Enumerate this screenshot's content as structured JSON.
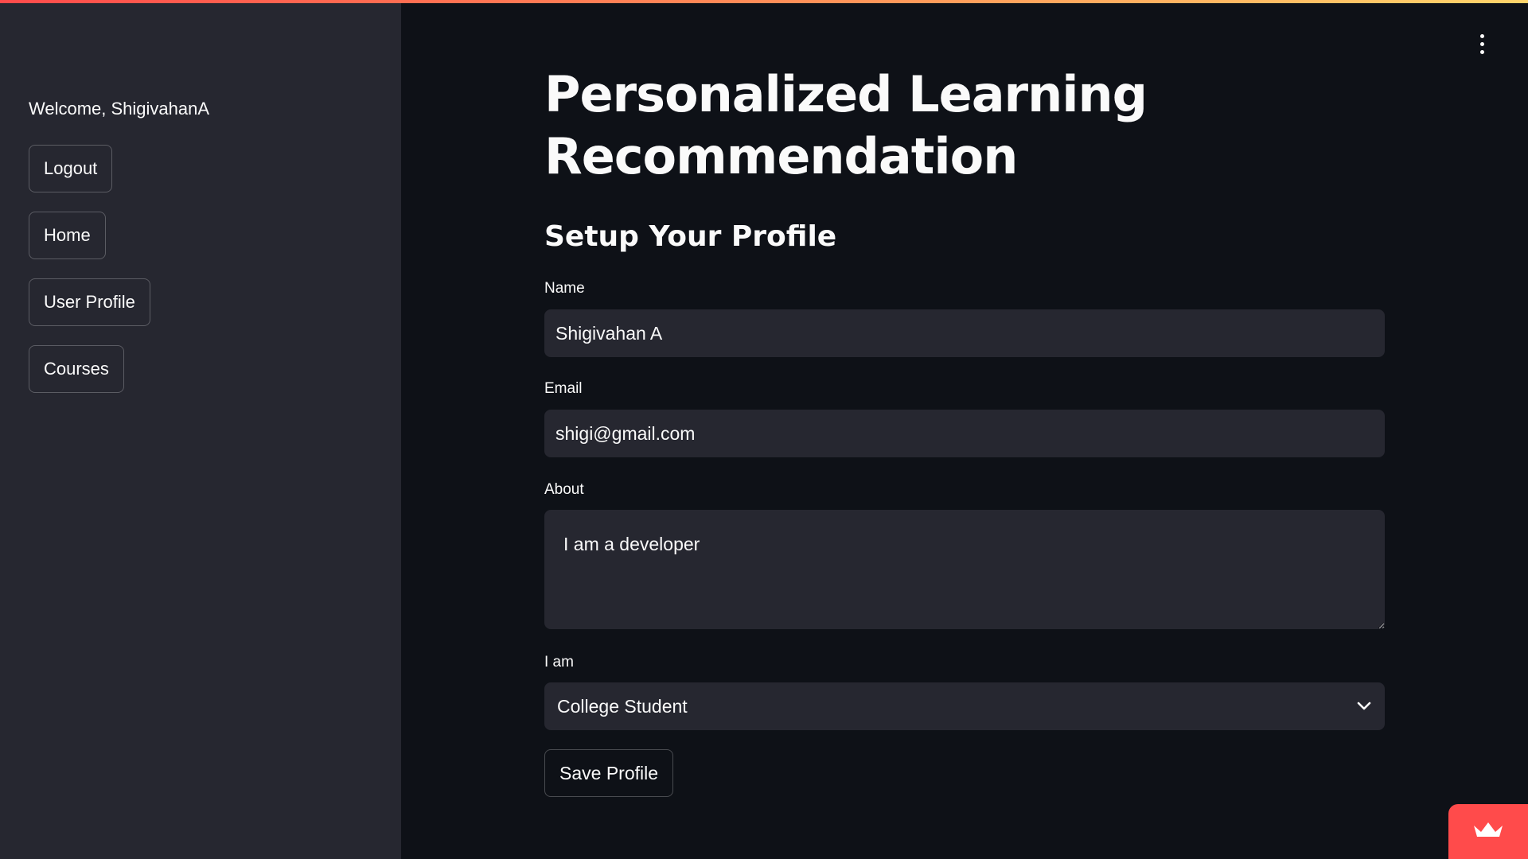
{
  "sidebar": {
    "welcome": "Welcome, ShigivahanA",
    "buttons": [
      "Logout",
      "Home",
      "User Profile",
      "Courses"
    ]
  },
  "main": {
    "title": "Personalized Learning Recommendation",
    "subtitle": "Setup Your Profile",
    "form": {
      "name_label": "Name",
      "name_value": "Shigivahan A",
      "email_label": "Email",
      "email_value": "shigi@gmail.com",
      "about_label": "About",
      "about_value": "I am a developer",
      "role_label": "I am",
      "role_value": "College Student",
      "save_label": "Save Profile"
    }
  },
  "icons": {
    "menu": "more-vertical-icon",
    "chevron": "chevron-down-icon",
    "badge": "streamlit-crown-icon"
  },
  "colors": {
    "background": "#0e1117",
    "sidebar": "#262730",
    "accent": "#ff4b4b",
    "text": "#fafafa"
  }
}
